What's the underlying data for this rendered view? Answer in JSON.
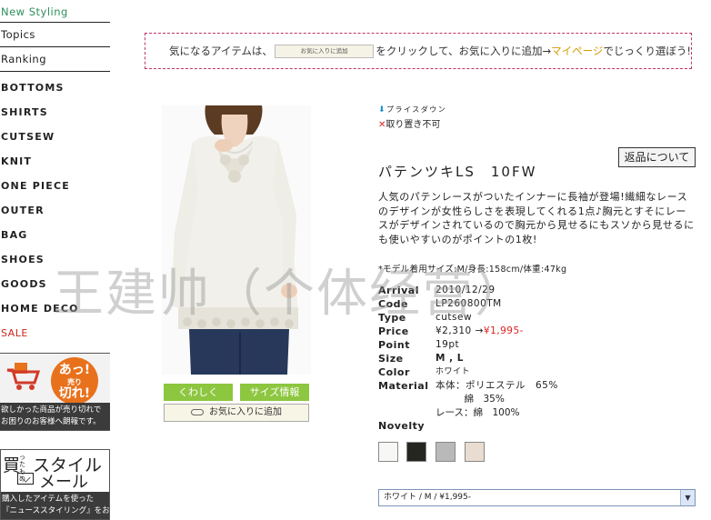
{
  "sidebar": {
    "top_items": [
      "New Styling",
      "Topics",
      "Ranking"
    ],
    "categories": [
      "BOTTOMS",
      "SHIRTS",
      "CUTSEW",
      "KNIT",
      "ONE PIECE",
      "OUTER",
      "BAG",
      "SHOES",
      "GOODS",
      "HOME DECO"
    ],
    "sale_label": "SALE",
    "banner_wishlist": {
      "burst_line1": "あっ!",
      "burst_line2": "売り",
      "burst_line3": "切れ!",
      "text_line1": "欲しかった商品が売り切れで",
      "text_line2": "お困りのお客様へ朗報です。"
    },
    "banner_mail": {
      "title": "買ったものスタイル",
      "title_small": "ったもの",
      "mail_word": "メール",
      "text_line1": "購入したアイテムを使った",
      "text_line2": "『ニューススタイリング』をお届け!"
    }
  },
  "notice": {
    "text_before": "気になるアイテムは、",
    "button_label": "お気に入りに追加",
    "text_middle": "をクリックして、お気に入りに追加→",
    "mypage_link": "マイページ",
    "text_after": "でじっくり選ぼう!"
  },
  "product": {
    "badge_price_down": "プライスダウン",
    "badge_no_hold": "取り置き不可",
    "returns_button": "返品について",
    "title": "パテンツキLS　10FW",
    "description": "人気のパテンレースがついたインナーに長袖が登場!繊細なレースのデザインが女性らしさを表現してくれる1点♪胸元とすそにレースがデザインされているので胸元から見せるにもスソから見せるにも使いやすいのがポイントの1枚!",
    "model_info": "*モデル着用サイズ:M/身長:158cm/体重:47kg",
    "specs": [
      {
        "label": "Arrival",
        "value": "2010/12/29"
      },
      {
        "label": "Code",
        "value": "LP260800TM"
      },
      {
        "label": "Type",
        "value": "cutsew"
      },
      {
        "label": "Price",
        "value": "¥2,310 → ",
        "sale": "¥1,995-"
      },
      {
        "label": "Point",
        "value": "19pt"
      },
      {
        "label": "Size",
        "value": "M , L"
      },
      {
        "label": "Color",
        "value": "ホワイト"
      },
      {
        "label": "Material",
        "value": "本体：ポリエステル　65%",
        "extra1": "　　　綿　35%",
        "extra2": "レース：綿　100%"
      }
    ],
    "novelty_label": "Novelty",
    "swatch_colors": [
      "#f7f7f5",
      "#24261f",
      "#b9b9b9",
      "#e9dcd0"
    ],
    "variant_selected": "ホワイト / M / ¥1,995-",
    "buttons": {
      "detail": "くわしく",
      "size_info": "サイズ情報",
      "add_favorite": "お気に入りに追加"
    }
  },
  "watermark": "王建帅（个体经营）",
  "colors": {
    "accent_green": "#8dc63f",
    "new_styling_green": "#2f8f5d",
    "sale_red": "#c8281e",
    "notice_border": "#c0306a",
    "mypage": "#d49b00"
  }
}
